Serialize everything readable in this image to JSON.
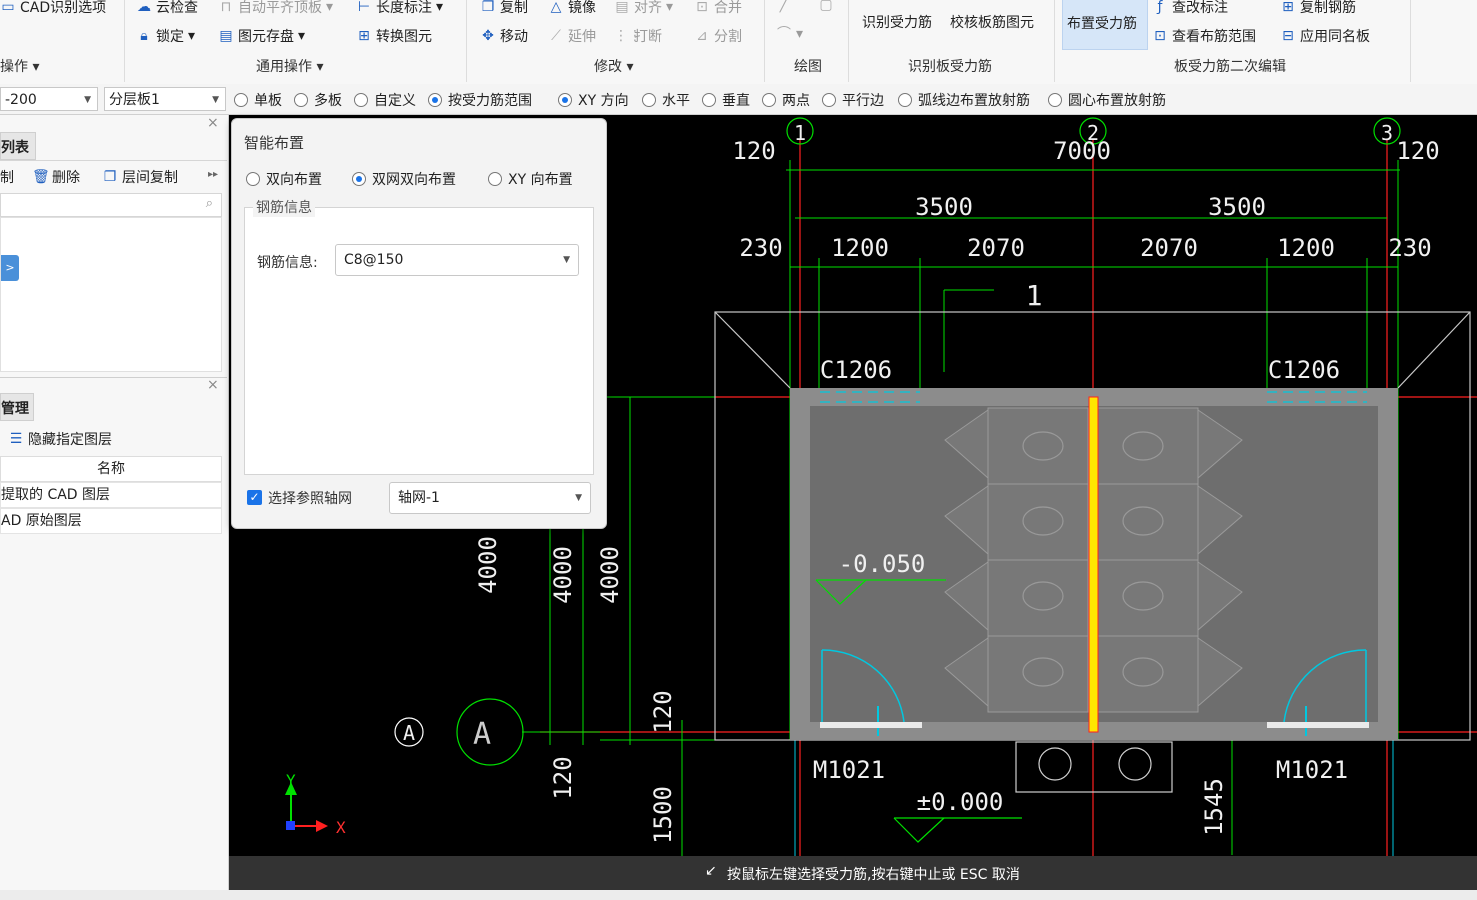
{
  "ribbon": {
    "groups": {
      "operation": "操作",
      "common_ops": "通用操作",
      "modify": "修改",
      "draw": "绘图",
      "identify_slab_bar": "识别板受力筋",
      "slab_bar_edit": "板受力筋二次编辑"
    },
    "items": {
      "cad_options": "CAD识别选项",
      "cloud_check": "云检查",
      "auto_align": "自动平齐顶板",
      "length_mark": "长度标注",
      "lock": "锁定",
      "element_save": "图元存盘",
      "convert_element": "转换图元",
      "copy": "复制",
      "mirror": "镜像",
      "align": "对齐",
      "merge": "合并",
      "move": "移动",
      "extend": "延伸",
      "break": "打断",
      "split": "分割",
      "identify_bar": "识别受力筋",
      "check_slab_bar": "校核板筋图元",
      "place_bar": "布置受力筋",
      "edit_mark": "查改标注",
      "copy_bar": "复制钢筋",
      "view_bar_range": "查看布筋范围",
      "apply_same_slab": "应用同名板"
    }
  },
  "optbar": {
    "elevation": "-200",
    "layer": "分层板1",
    "radios": [
      "单板",
      "多板",
      "自定义",
      "按受力筋范围",
      "XY 方向",
      "水平",
      "垂直",
      "两点",
      "平行边",
      "弧线边布置放射筋",
      "圆心布置放射筋"
    ]
  },
  "left": {
    "list_title": "列表",
    "btn_copy": "制",
    "btn_delete": "删除",
    "btn_floor_copy": "层间复制",
    "layer_title": "管理",
    "hide_layer": "隐藏指定图层",
    "col_name": "名称",
    "rows": [
      "提取的 CAD 图层",
      "AD 原始图层"
    ]
  },
  "dialog": {
    "title": "智能布置",
    "options": [
      "双向布置",
      "双网双向布置",
      "XY 向布置"
    ],
    "group_label": "钢筋信息",
    "field_label": "钢筋信息:",
    "field_value": "C8@150",
    "checkbox_label": "选择参照轴网",
    "axis_value": "轴网-1"
  },
  "drawing": {
    "axis_labels": [
      "1",
      "2",
      "3",
      "A",
      "A"
    ],
    "dims_top": [
      "120",
      "7000",
      "120"
    ],
    "dims_mid": [
      "3500",
      "3500"
    ],
    "dims_low": [
      "230",
      "1200",
      "2070",
      "2070",
      "1200",
      "230"
    ],
    "section": "1",
    "windows": [
      "C1206",
      "C1206"
    ],
    "doors": [
      "M1021",
      "M1021"
    ],
    "levels": [
      "-0.050",
      "±0.000"
    ],
    "vdims": [
      "4000",
      "4000",
      "4000",
      "120",
      "120",
      "1500",
      "1545"
    ],
    "axis_x": "X",
    "axis_y": "Y"
  },
  "status": "按鼠标左键选择受力筋,按右键中止或 ESC 取消"
}
